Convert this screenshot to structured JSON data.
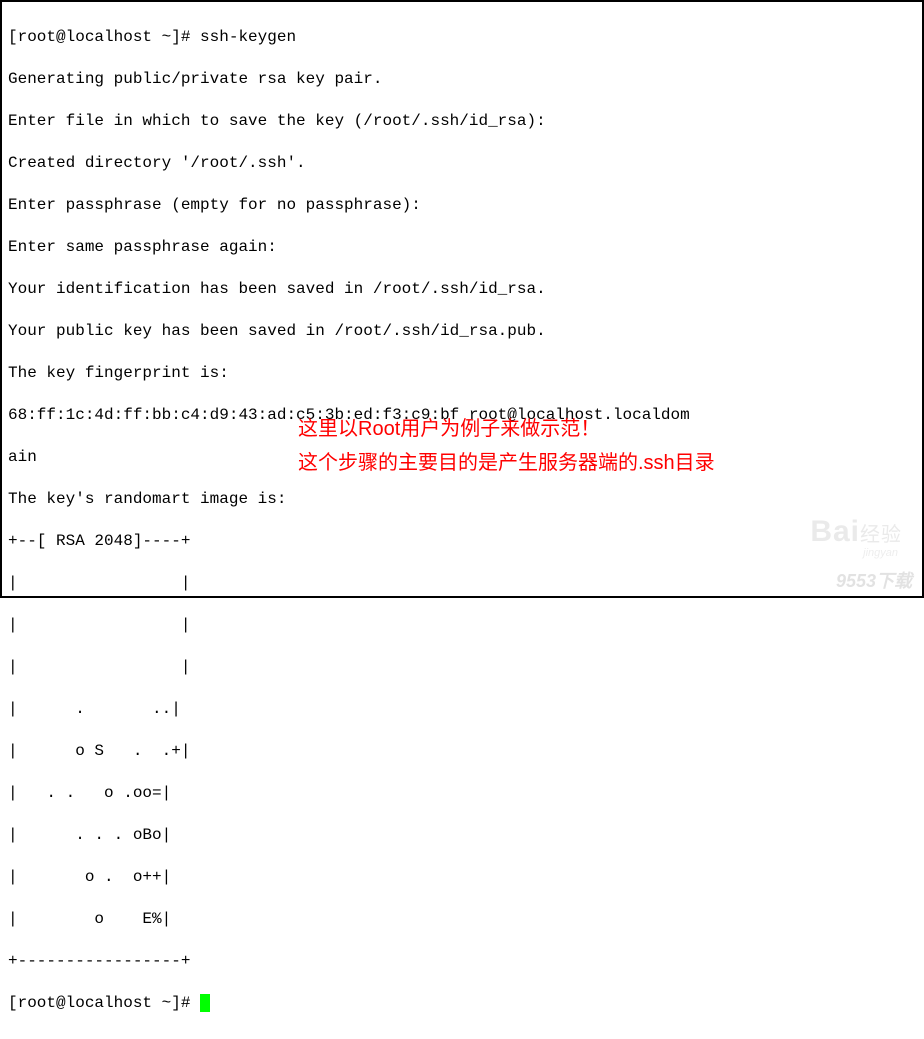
{
  "terminal": {
    "lines": [
      "[root@localhost ~]# ssh-keygen",
      "Generating public/private rsa key pair.",
      "Enter file in which to save the key (/root/.ssh/id_rsa):",
      "Created directory '/root/.ssh'.",
      "Enter passphrase (empty for no passphrase):",
      "Enter same passphrase again:",
      "Your identification has been saved in /root/.ssh/id_rsa.",
      "Your public key has been saved in /root/.ssh/id_rsa.pub.",
      "The key fingerprint is:",
      "68:ff:1c:4d:ff:bb:c4:d9:43:ad:c5:3b:ed:f3:c9:bf root@localhost.localdom",
      "ain",
      "The key's randomart image is:",
      "+--[ RSA 2048]----+",
      "|                 |",
      "|                 |",
      "|                 |",
      "|      .       ..|",
      "|      o S   .  .+|",
      "|   . .   o .oo=|",
      "|      . . . oBo|",
      "|       o .  o++|",
      "|        o    E%|",
      "+-----------------+"
    ],
    "prompt": "[root@localhost ~]# "
  },
  "annotations": {
    "line1": "这里以Root用户为例子来做示范！",
    "line2": "这个步骤的主要目的是产生服务器端的.ssh目录"
  },
  "watermarks": {
    "baidu_prefix": "Bai",
    "baidu_suffix": "经验",
    "baidu_sub": "jingyan",
    "site": "9553下载"
  }
}
